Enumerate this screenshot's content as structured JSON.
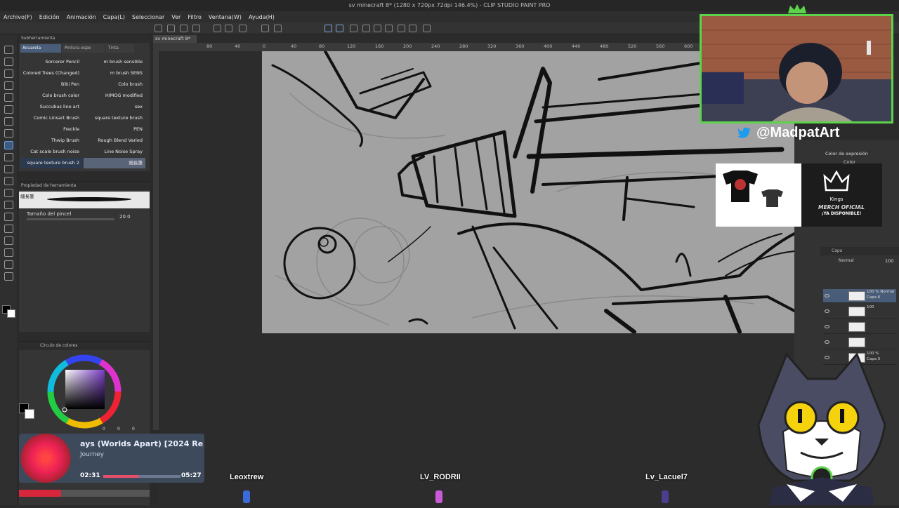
{
  "window": {
    "title": "sv minecraft 8* (1280 x 720px 72dpi 146.4%) - CLIP STUDIO PAINT PRO"
  },
  "menu": [
    "Archivo(F)",
    "Edición",
    "Animación",
    "Capa(L)",
    "Seleccionar",
    "Ver",
    "Filtro",
    "Ventana(W)",
    "Ayuda(H)"
  ],
  "document_tab": "sv minecraft 8*",
  "ruler_ticks": [
    "80",
    "40",
    "0",
    "40",
    "80",
    "120",
    "160",
    "200",
    "240",
    "280",
    "320",
    "360",
    "400",
    "440",
    "480",
    "520",
    "560",
    "600"
  ],
  "brush_panel": {
    "header": "Subherramienta",
    "tabs": [
      "Acuarela",
      "Pintura espe",
      "Tinta"
    ],
    "brushes_left": [
      "Sorcerer Pencil",
      "Colored Trees (Changed)",
      "Bibi Pen",
      "Colo brush color",
      "Succubus line art",
      "Comic Linsart Brush",
      "Freckle",
      "Thwip Brush",
      "Cat scale brush noise",
      "square texture brush 2"
    ],
    "brushes_right": [
      "m brush sensible",
      "m brush SENS",
      "Colo brush",
      "HIMOG modified",
      "sex",
      "square texture brush",
      "PEN",
      "Rough Blend Varied",
      "Line Noise Spray",
      "細長筆"
    ]
  },
  "tool_property": {
    "header": "Propiedad de herramienta",
    "brush_name": "細長筆",
    "size_label": "Tamaño del pincel",
    "size_value": "20.0"
  },
  "color_panel": {
    "header": "Círculo de colores",
    "values": [
      "0",
      "0",
      "0"
    ]
  },
  "right_panel": {
    "expression_label": "Color de expresión",
    "expression_value": "Color",
    "layer_header": "Capa",
    "opacity": "100",
    "blend": "Normal",
    "layers": [
      {
        "name": "Capa 6",
        "opacity": "100 % Normal"
      },
      {
        "name": "",
        "opacity": "100"
      },
      {
        "name": "",
        "opacity": ""
      },
      {
        "name": "",
        "opacity": ""
      },
      {
        "name": "Capa 5",
        "opacity": "100 %"
      }
    ]
  },
  "stream": {
    "handle": "@MadpatArt",
    "merch_brand": "Kings",
    "merch_line1": "MERCH OFICIAL",
    "merch_line2": "¡YA DISPONIBLE!"
  },
  "player": {
    "title": "ays (Worlds Apart) [2024 Re",
    "artist": "Journey",
    "elapsed": "02:31",
    "total": "05:27",
    "progress_fraction": 0.46
  },
  "viewers": [
    "Leoxtrew",
    "LV_RODRII",
    "Lv_Lacuel7"
  ],
  "colors": {
    "accent_green": "#5cd34a",
    "canvas_gray": "#a2a2a2",
    "player_bg": "#3d4a5c"
  }
}
